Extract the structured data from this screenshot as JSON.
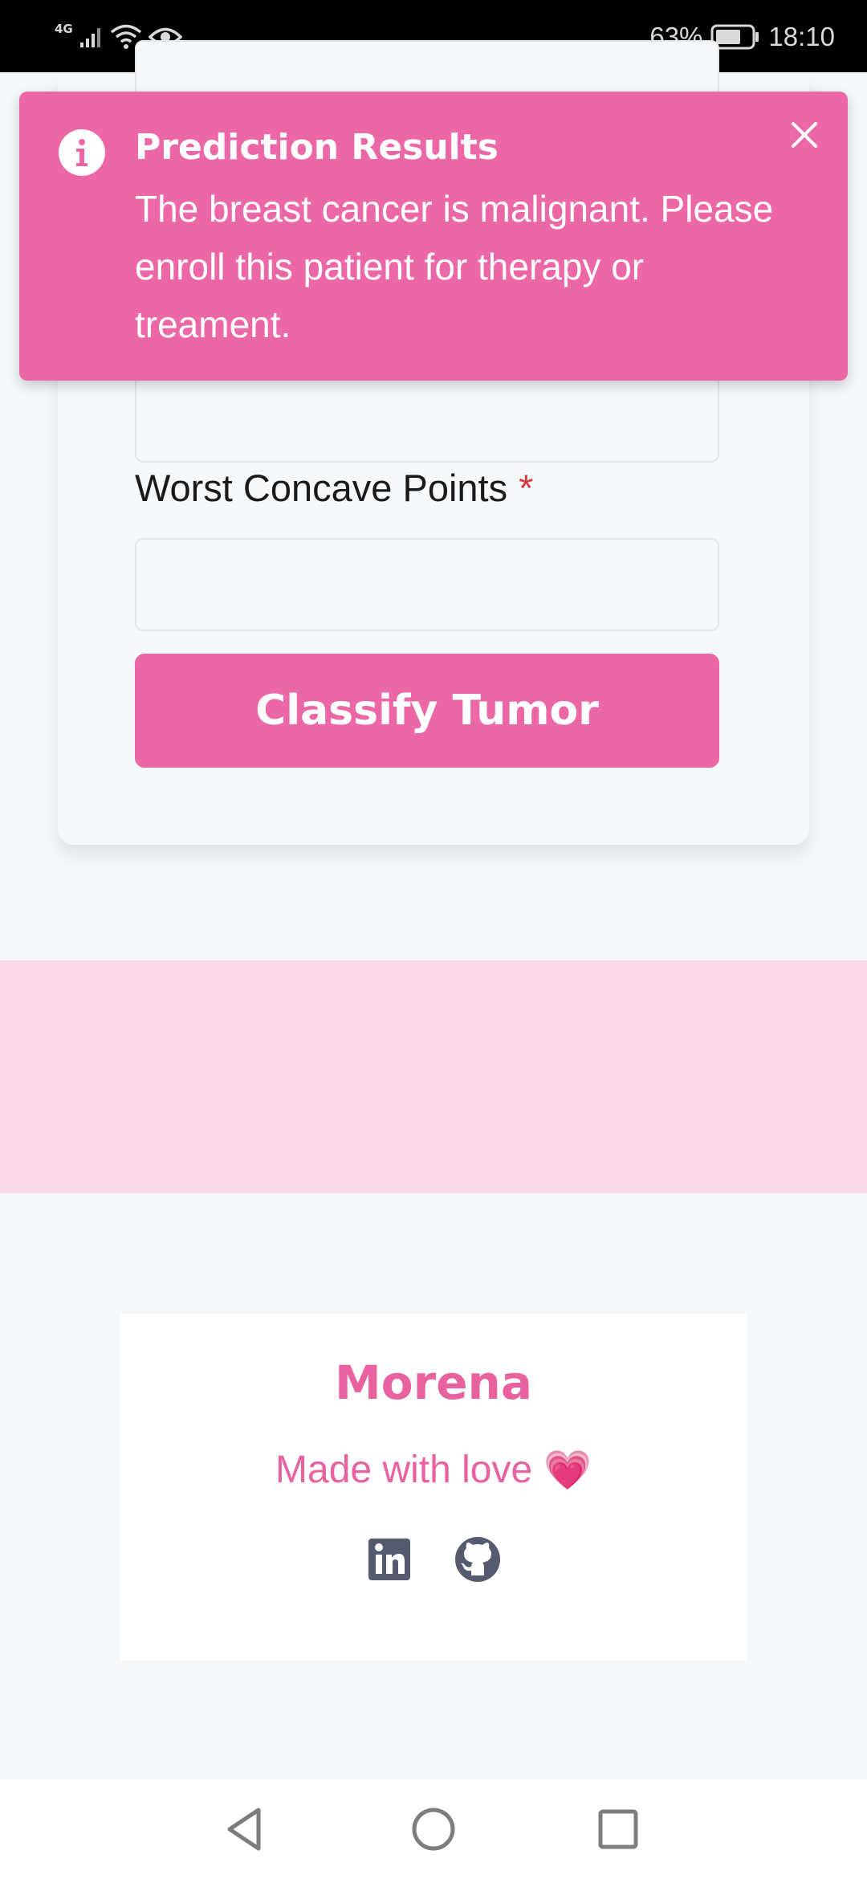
{
  "status_bar": {
    "network_type": "4G",
    "battery": "63%",
    "time": "18:10"
  },
  "toast": {
    "title": "Prediction Results",
    "message": "The breast cancer is malignant. Please enroll this patient for therapy or treament.",
    "icon": "info-icon",
    "close_icon": "close-icon",
    "background_color": "#eb67a6"
  },
  "form": {
    "worst_concave_points": {
      "label": "Worst Concave Points",
      "required_marker": "*",
      "value": ""
    },
    "submit_label": "Classify Tumor",
    "accent_color": "#eb67a6"
  },
  "footer": {
    "brand": "Morena",
    "tagline": "Made with love",
    "tagline_emoji": "💗",
    "social_icons": [
      "linkedin-icon",
      "github-icon"
    ]
  },
  "nav_bar": {
    "buttons": [
      "back",
      "home",
      "recents"
    ]
  },
  "colors": {
    "pink_band": "#fbd9e8",
    "page_background": "#f6f9fc",
    "brand_pink": "#e7629f"
  }
}
